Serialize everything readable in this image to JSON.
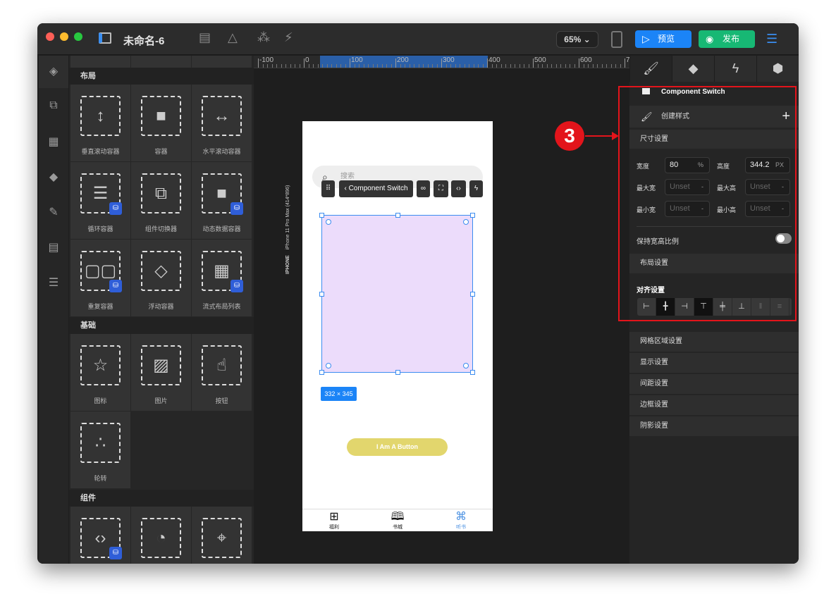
{
  "window": {
    "title": "未命名-6",
    "zoom": "65%",
    "preview": "预览",
    "publish": "发布"
  },
  "library": {
    "sections": [
      {
        "title": "布局",
        "items": [
          {
            "label": "垂直滚动容器",
            "icon": "vertical-scroll-icon"
          },
          {
            "label": "容器",
            "icon": "container-icon"
          },
          {
            "label": "水平滚动容器",
            "icon": "horizontal-scroll-icon"
          },
          {
            "label": "循环容器",
            "icon": "loop-container-icon"
          },
          {
            "label": "组件切换器",
            "icon": "component-switch-icon"
          },
          {
            "label": "动态数据容器",
            "icon": "dynamic-data-icon"
          },
          {
            "label": "重复容器",
            "icon": "repeat-container-icon"
          },
          {
            "label": "浮动容器",
            "icon": "float-container-icon"
          },
          {
            "label": "流式布局列表",
            "icon": "flow-list-icon"
          }
        ]
      },
      {
        "title": "基础",
        "items": [
          {
            "label": "图标",
            "icon": "star-icon"
          },
          {
            "label": "图片",
            "icon": "image-icon"
          },
          {
            "label": "按钮",
            "icon": "button-icon"
          },
          {
            "label": "轮转",
            "icon": "spinner-icon"
          }
        ]
      },
      {
        "title": "组件",
        "items": [
          {
            "label": "",
            "icon": "code-component-icon"
          },
          {
            "label": "",
            "icon": "timer-icon"
          },
          {
            "label": "",
            "icon": "map-pin-icon"
          }
        ]
      }
    ]
  },
  "canvas": {
    "ruler": [
      "-100",
      "0",
      "100",
      "200",
      "300",
      "400",
      "500",
      "600",
      "7"
    ],
    "device_label": "IPHONE",
    "device_model": "iPhone 11 Pro Max (414*896)",
    "search_placeholder": "搜索",
    "toolbar_label": "Component Switch",
    "size_label": "332 × 345",
    "button_label": "I Am A Button",
    "tabs": [
      {
        "label": "福利",
        "icon": "gift-icon"
      },
      {
        "label": "书城",
        "icon": "book-icon"
      },
      {
        "label": "听书",
        "icon": "command-icon",
        "active": true
      }
    ],
    "accent": "#1b84f7"
  },
  "inspector": {
    "component_name": "Component Switch",
    "create_style": "创建样式",
    "size_section": "尺寸设置",
    "fields": {
      "width_label": "宽度",
      "width_value": "80",
      "width_unit": "%",
      "height_label": "高度",
      "height_value": "344.2",
      "height_unit": "PX",
      "max_width_label": "最大宽",
      "max_width": "Unset",
      "max_height_label": "最大高",
      "max_height": "Unset",
      "min_width_label": "最小宽",
      "min_width": "Unset",
      "min_height_label": "最小高",
      "min_height": "Unset",
      "dash": "-"
    },
    "keep_ratio": "保持宽高比例",
    "keep_ratio_on": false,
    "layout_section": "布局设置",
    "align_section": "对齐设置",
    "sections": [
      "网格区域设置",
      "显示设置",
      "间距设置",
      "边框设置",
      "阴影设置"
    ]
  },
  "annotation": {
    "number": "3",
    "color": "#e3141b"
  }
}
